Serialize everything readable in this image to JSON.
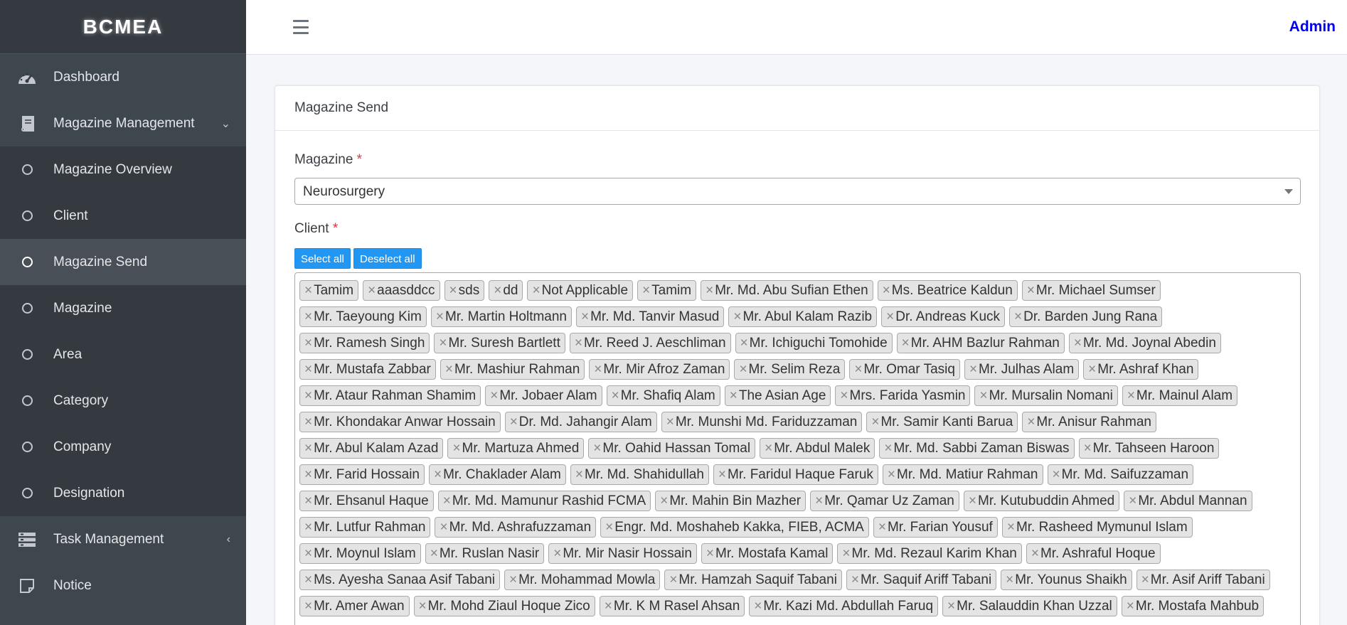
{
  "brand": "BCMEA",
  "sidebar": {
    "items": [
      {
        "label": "Dashboard",
        "icon": "dashboard-icon"
      },
      {
        "label": "Magazine Management",
        "icon": "book-icon",
        "caret": "⌄"
      },
      {
        "label": "Magazine Overview",
        "icon": "circle-icon"
      },
      {
        "label": "Client",
        "icon": "circle-icon"
      },
      {
        "label": "Magazine Send",
        "icon": "circle-icon"
      },
      {
        "label": "Magazine",
        "icon": "circle-icon"
      },
      {
        "label": "Area",
        "icon": "circle-icon"
      },
      {
        "label": "Category",
        "icon": "circle-icon"
      },
      {
        "label": "Company",
        "icon": "circle-icon"
      },
      {
        "label": "Designation",
        "icon": "circle-icon"
      },
      {
        "label": "Task Management",
        "icon": "tasks-icon",
        "caret": "‹"
      },
      {
        "label": "Notice",
        "icon": "note-icon"
      }
    ]
  },
  "header": {
    "user": "Admin"
  },
  "card": {
    "title": "Magazine Send",
    "magazine_label": "Magazine",
    "magazine_value": "Neurosurgery",
    "client_label": "Client",
    "required_mark": "*",
    "select_all": "Select all",
    "deselect_all": "Deselect all",
    "remove_mark": "×"
  },
  "clients": [
    "Tamim",
    "aaasddcc",
    "sds",
    "dd",
    "Not Applicable",
    "Tamim",
    "Mr. Md. Abu Sufian Ethen",
    "Ms. Beatrice Kaldun",
    "Mr. Michael Sumser",
    "Mr. Taeyoung Kim",
    "Mr. Martin Holtmann",
    "Mr. Md. Tanvir Masud",
    "Mr. Abul Kalam Razib",
    "Dr. Andreas Kuck",
    "Dr. Barden Jung Rana",
    "Mr. Ramesh Singh",
    "Mr. Suresh Bartlett",
    "Mr. Reed J. Aeschliman",
    "Mr. Ichiguchi Tomohide",
    "Mr. AHM Bazlur Rahman",
    "Mr. Md. Joynal Abedin",
    "Mr. Mustafa Zabbar",
    "Mr. Mashiur Rahman",
    "Mr. Mir Afroz Zaman",
    "Mr. Selim Reza",
    "Mr. Omar Tasiq",
    "Mr. Julhas Alam",
    "Mr. Ashraf Khan",
    "Mr. Ataur Rahman Shamim",
    "Mr. Jobaer Alam",
    "Mr. Shafiq Alam",
    "The Asian Age",
    "Mrs. Farida Yasmin",
    "Mr. Mursalin Nomani",
    "Mr. Mainul Alam",
    "Mr. Khondakar Anwar Hossain",
    "Dr. Md. Jahangir Alam",
    "Mr. Munshi Md. Fariduzzaman",
    "Mr. Samir Kanti Barua",
    "Mr. Anisur Rahman",
    "Mr. Abul Kalam Azad",
    "Mr. Martuza Ahmed",
    "Mr. Oahid Hassan Tomal",
    "Mr. Abdul Malek",
    "Mr. Md. Sabbi Zaman Biswas",
    "Mr. Tahseen Haroon",
    "Mr. Farid Hossain",
    "Mr. Chaklader Alam",
    "Mr. Md. Shahidullah",
    "Mr. Faridul Haque Faruk",
    "Mr. Md. Matiur Rahman",
    "Mr. Md. Saifuzzaman",
    "Mr. Ehsanul Haque",
    "Mr. Md. Mamunur Rashid FCMA",
    "Mr. Mahin Bin Mazher",
    "Mr. Qamar Uz Zaman",
    "Mr. Kutubuddin Ahmed",
    "Mr. Abdul Mannan",
    "Mr. Lutfur Rahman",
    "Mr. Md. Ashrafuzzaman",
    "Engr. Md. Moshaheb Kakka, FIEB, ACMA",
    "Mr. Farian Yousuf",
    "Mr. Rasheed Mymunul Islam",
    "Mr. Moynul Islam",
    "Mr. Ruslan Nasir",
    "Mr. Mir Nasir Hossain",
    "Mr. Mostafa Kamal",
    "Mr. Md. Rezaul Karim Khan",
    "Mr. Ashraful Hoque",
    "Ms. Ayesha Sanaa Asif Tabani",
    "Mr. Mohammad Mowla",
    "Mr. Hamzah Saquif Tabani",
    "Mr. Saquif Ariff Tabani",
    "Mr. Younus Shaikh",
    "Mr. Asif Ariff Tabani",
    "Mr. Amer Awan",
    "Mr. Mohd Ziaul Hoque Zico",
    "Mr. K M Rasel Ahsan",
    "Mr. Kazi Md. Abdullah Faruq",
    "Mr. Salauddin Khan Uzzal",
    "Mr. Mostafa Mahbub"
  ]
}
